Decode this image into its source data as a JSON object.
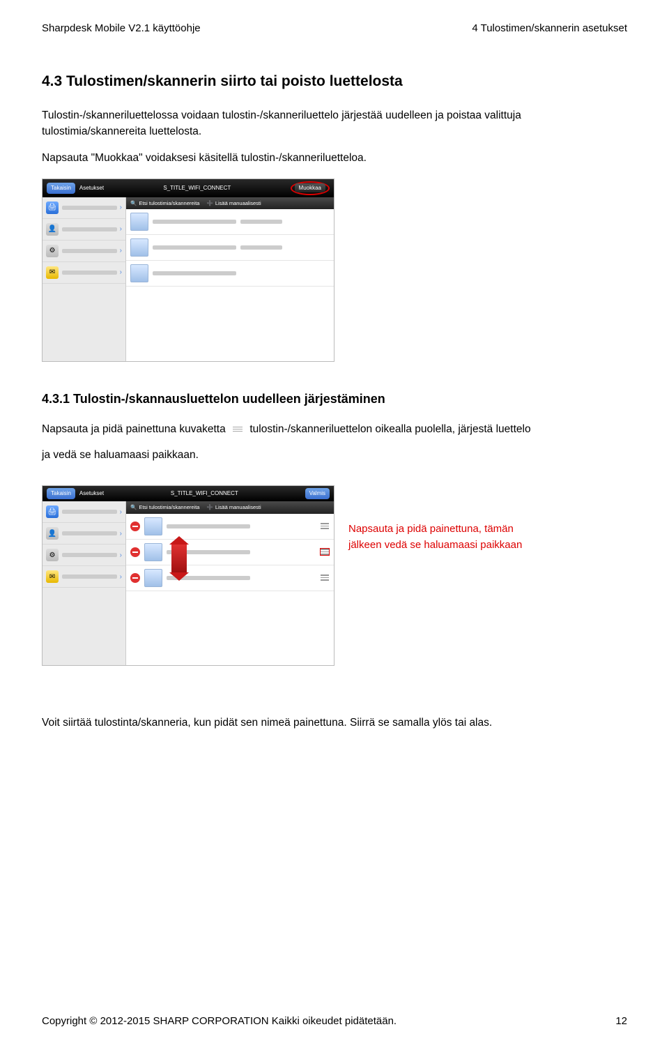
{
  "header": {
    "left": "Sharpdesk Mobile V2.1 käyttöohje",
    "right": "4 Tulostimen/skannerin asetukset"
  },
  "section": {
    "title": "4.3 Tulostimen/skannerin siirto tai poisto luettelosta",
    "intro": "Tulostin-/skanneriluettelossa voidaan tulostin-/skanneriluettelo järjestää uudelleen ja poistaa valittuja tulostimia/skannereita luettelosta.",
    "muokkaa_line_prefix": "Napsauta ",
    "muokkaa_quoted": "\"Muokkaa\"",
    "muokkaa_line_suffix": " voidaksesi käsitellä tulostin-/skanneriluetteloa."
  },
  "screenshot1": {
    "back": "Takaisin",
    "title_left": "Asetukset",
    "title_center": "S_TITLE_WIFI_CONNECT",
    "btn_right": "Muokkaa",
    "hdr_a_icon": "🔍",
    "hdr_a": "Etsi tulostimia/skannereita",
    "hdr_b_icon": "➕",
    "hdr_b": "Lisää manuaalisesti"
  },
  "subsection": {
    "title": "4.3.1 Tulostin-/skannausluettelon uudelleen järjestäminen",
    "line1_a": "Napsauta ja pidä painettuna kuvaketta",
    "line1_b": "tulostin-/skanneriluettelon oikealla puolella, järjestä luettelo",
    "line2": "ja vedä se haluamaasi paikkaan."
  },
  "screenshot2": {
    "back": "Takaisin",
    "title_left": "Asetukset",
    "title_center": "S_TITLE_WIFI_CONNECT",
    "btn_right": "Valmis",
    "hdr_a_icon": "🔍",
    "hdr_a": "Etsi tulostimia/skannereita",
    "hdr_b_icon": "➕",
    "hdr_b": "Lisää manuaalisesti"
  },
  "callout": {
    "line1": "Napsauta ja pidä painettuna, tämän",
    "line2": "jälkeen vedä se haluamaasi paikkaan"
  },
  "bottom_note": "Voit siirtää tulostinta/skanneria, kun pidät sen nimeä painettuna. Siirrä se samalla ylös tai alas.",
  "footer": {
    "copyright": "Copyright © 2012-2015 SHARP CORPORATION Kaikki oikeudet pidätetään.",
    "page": "12"
  }
}
